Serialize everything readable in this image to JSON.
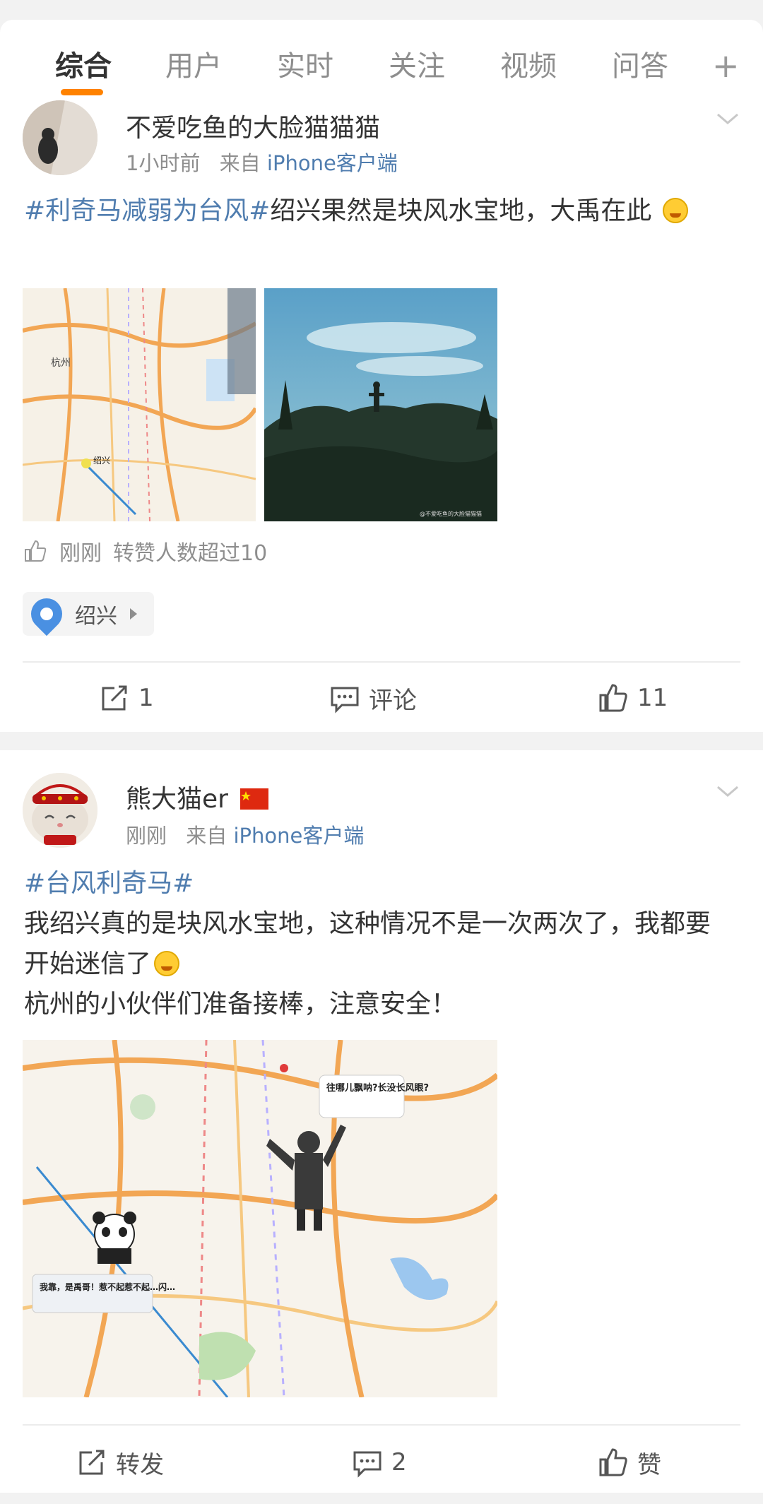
{
  "tabs": [
    {
      "label": "综合",
      "active": true
    },
    {
      "label": "用户"
    },
    {
      "label": "实时"
    },
    {
      "label": "关注"
    },
    {
      "label": "视频"
    },
    {
      "label": "问答"
    }
  ],
  "tab_plus": "+",
  "accent_color": "#ff8200",
  "link_color": "#507daf",
  "posts": [
    {
      "username": "不爱吃鱼的大脸猫猫猫",
      "time": "1小时前",
      "from_prefix": "来自",
      "source": "iPhone客户端",
      "topic": "#利奇马减弱为台风#",
      "text": "绍兴果然是块风水宝地，大禹在此",
      "like_note_time": "刚刚",
      "like_note_text": "转赞人数超过10",
      "location": "绍兴",
      "repost_count": "1",
      "comment_label": "评论",
      "like_count": "11",
      "image_watermark": "@不爱吃鱼的大脸猫猫猫",
      "map_labels": [
        "杭州",
        "绍兴"
      ]
    },
    {
      "username": "熊大猫er",
      "flag": "CN-flag-icon",
      "time": "刚刚",
      "from_prefix": "来自",
      "source": "iPhone客户端",
      "topic": "#台风利奇马#",
      "line1": "我绍兴真的是块风水宝地，这种情况不是一次两次了，我都要开始迷信了",
      "line2": "杭州的小伙伴们准备接棒，注意安全！",
      "repost_label": "转发",
      "comment_count": "2",
      "like_label": "赞",
      "bubble_1": "往哪儿飘呐?长没长风眼?",
      "bubble_2": "我靠，是禹哥！惹不起惹不起…闪…"
    }
  ]
}
